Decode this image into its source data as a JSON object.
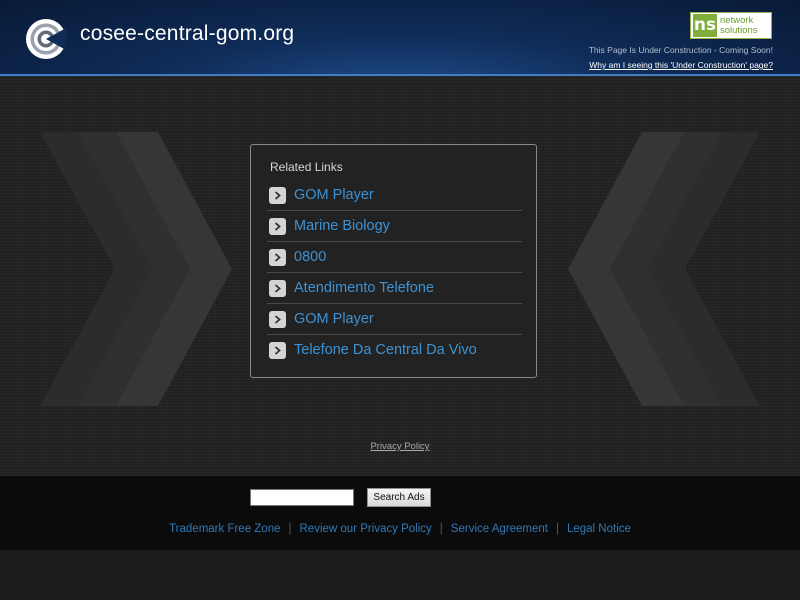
{
  "header": {
    "site_title": "cosee-central-gom.org",
    "logo_icon": "target-logo-icon",
    "provider_badge": {
      "mark": "ns",
      "line1": "network",
      "line2": "solutions",
      "color": "#7fae3a"
    },
    "construction_notice": "This Page Is Under Construction - Coming Soon!",
    "why_link": "Why am I seeing this 'Under Construction' page?"
  },
  "related": {
    "title": "Related Links",
    "link_color": "#3d92d4",
    "items": [
      {
        "label": "GOM Player"
      },
      {
        "label": "Marine Biology"
      },
      {
        "label": "0800"
      },
      {
        "label": "Atendimento Telefone"
      },
      {
        "label": "GOM Player"
      },
      {
        "label": "Telefone Da Central Da Vivo"
      }
    ]
  },
  "privacy_link": "Privacy Policy",
  "footer": {
    "search": {
      "value": "",
      "button_label": "Search Ads"
    },
    "links": [
      {
        "label": "Trademark Free Zone"
      },
      {
        "label": "Review our Privacy Policy"
      },
      {
        "label": "Service Agreement"
      },
      {
        "label": "Legal Notice"
      }
    ],
    "separator": "|"
  }
}
